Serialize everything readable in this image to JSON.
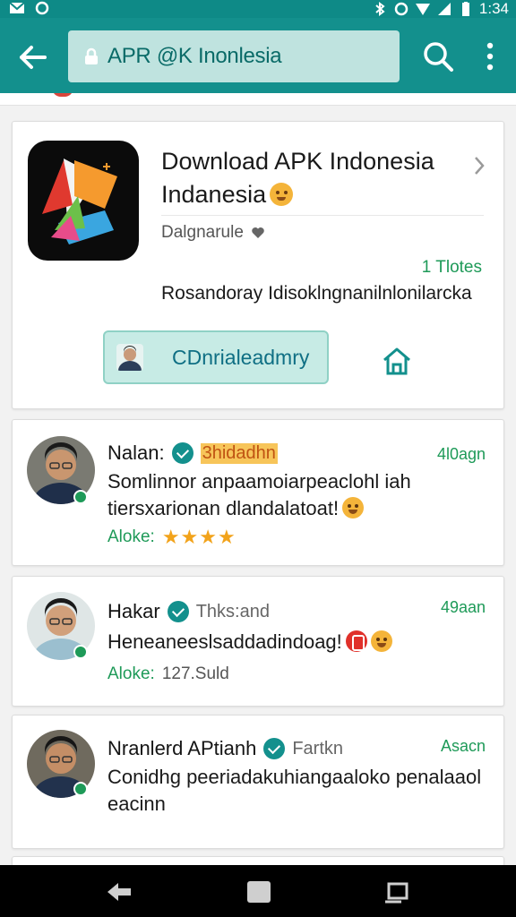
{
  "status_bar": {
    "time": "1:34"
  },
  "app_bar": {
    "url_text": "APR @K Inonlesia"
  },
  "app_card": {
    "title_line1": "Download APK Indonesia",
    "title_line2": "Indanesia",
    "developer": "Dalgnarule",
    "rating_text": "1 Tlotes",
    "description": "Rosandoray Idisoklngnanilnlonilarcka",
    "download_button_label": "CDnrialeadmry"
  },
  "reviews": [
    {
      "name": "Nalan:",
      "tag": "3hidadhn",
      "tag_highlight": true,
      "time": "4l0agn",
      "text": "Somlinnor anpaamoiarpeaclohl iah tiersxarionan dlandalatoat!",
      "meta_label": "Aloke:",
      "meta_value": "",
      "stars": "★★★★",
      "emoji": [
        "yellow"
      ]
    },
    {
      "name": "Hakar",
      "tag": "Thks:and",
      "tag_highlight": false,
      "time": "49aan",
      "text": "Heneaneeslsaddadindoag!",
      "meta_label": "Aloke:",
      "meta_value": "127.Suld",
      "stars": "",
      "emoji": [
        "red",
        "yellow"
      ]
    },
    {
      "name": "Nranlerd APtianh",
      "tag": "Fartkn",
      "tag_highlight": false,
      "time": "Asacn",
      "text": "Conidhg peeriadakuhiangaaloko penalaaol eacinn",
      "meta_label": "",
      "meta_value": "",
      "stars": "",
      "emoji": []
    }
  ],
  "colors": {
    "app_bar": "#13908d",
    "status_bar": "#0e8a87",
    "accent_green": "#1e9a58",
    "button_bg": "#c7ebe5"
  },
  "icons": {
    "back": "arrow-left-icon",
    "lock": "lock-icon",
    "search": "search-icon",
    "more": "more-vert-icon",
    "chevron": "chevron-right-icon",
    "home": "home-icon"
  }
}
